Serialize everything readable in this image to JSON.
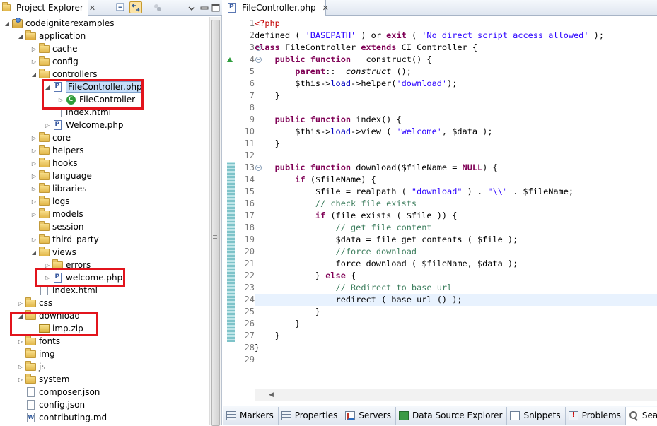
{
  "explorer": {
    "tab_title": "Project Explorer",
    "close_glyph": "✕",
    "toolbar": [
      "collapse-all-icon",
      "link-with-editor-icon",
      "filters-icon",
      "view-menu-icon"
    ],
    "tree": [
      {
        "label": "codeigniterexamples",
        "depth": 0,
        "type": "project",
        "expanded": true
      },
      {
        "label": "application",
        "depth": 1,
        "type": "folder",
        "expanded": true
      },
      {
        "label": "cache",
        "depth": 2,
        "type": "folder",
        "expanded": false
      },
      {
        "label": "config",
        "depth": 2,
        "type": "folder",
        "expanded": false
      },
      {
        "label": "controllers",
        "depth": 2,
        "type": "folder",
        "expanded": true
      },
      {
        "label": "FileController.php",
        "depth": 3,
        "type": "php",
        "expanded": true,
        "selected": true,
        "highlighted": true
      },
      {
        "label": "FileController",
        "depth": 4,
        "type": "class",
        "expanded": false,
        "highlighted": true
      },
      {
        "label": "index.html",
        "depth": 3,
        "type": "file",
        "expanded": null
      },
      {
        "label": "Welcome.php",
        "depth": 3,
        "type": "php",
        "expanded": false
      },
      {
        "label": "core",
        "depth": 2,
        "type": "folder",
        "expanded": false
      },
      {
        "label": "helpers",
        "depth": 2,
        "type": "folder",
        "expanded": false
      },
      {
        "label": "hooks",
        "depth": 2,
        "type": "folder",
        "expanded": false
      },
      {
        "label": "language",
        "depth": 2,
        "type": "folder",
        "expanded": false
      },
      {
        "label": "libraries",
        "depth": 2,
        "type": "folder",
        "expanded": false
      },
      {
        "label": "logs",
        "depth": 2,
        "type": "folder",
        "expanded": false
      },
      {
        "label": "models",
        "depth": 2,
        "type": "folder",
        "expanded": false
      },
      {
        "label": "session",
        "depth": 2,
        "type": "folder",
        "expanded": null
      },
      {
        "label": "third_party",
        "depth": 2,
        "type": "folder",
        "expanded": false
      },
      {
        "label": "views",
        "depth": 2,
        "type": "folder",
        "expanded": true
      },
      {
        "label": "errors",
        "depth": 3,
        "type": "folder",
        "expanded": false
      },
      {
        "label": "welcome.php",
        "depth": 3,
        "type": "php",
        "expanded": false,
        "highlighted": true
      },
      {
        "label": "index.html",
        "depth": 2,
        "type": "file",
        "expanded": null
      },
      {
        "label": "css",
        "depth": 1,
        "type": "folder",
        "expanded": false
      },
      {
        "label": "download",
        "depth": 1,
        "type": "folder",
        "expanded": true,
        "highlighted": true
      },
      {
        "label": "imp.zip",
        "depth": 2,
        "type": "zip",
        "expanded": null,
        "highlighted": true
      },
      {
        "label": "fonts",
        "depth": 1,
        "type": "folder",
        "expanded": false
      },
      {
        "label": "img",
        "depth": 1,
        "type": "folder",
        "expanded": null
      },
      {
        "label": "js",
        "depth": 1,
        "type": "folder",
        "expanded": false
      },
      {
        "label": "system",
        "depth": 1,
        "type": "folder",
        "expanded": false
      },
      {
        "label": "composer.json",
        "depth": 1,
        "type": "file",
        "expanded": null
      },
      {
        "label": "config.json",
        "depth": 1,
        "type": "file",
        "expanded": null
      },
      {
        "label": "contributing.md",
        "depth": 1,
        "type": "word",
        "expanded": null
      }
    ]
  },
  "editor": {
    "tab_title": "FileController.php",
    "close_glyph": "✕",
    "current_line": 24,
    "lines": [
      [
        [
          "tag",
          "<?php"
        ]
      ],
      [
        [
          "t",
          "defined ( "
        ],
        [
          "str",
          "'BASEPATH'"
        ],
        [
          "t",
          " ) or "
        ],
        [
          "kw",
          "exit"
        ],
        [
          "t",
          " ( "
        ],
        [
          "str",
          "'No direct script access allowed'"
        ],
        [
          "t",
          " );"
        ]
      ],
      [
        [
          "kw",
          "class"
        ],
        [
          "t",
          " FileController "
        ],
        [
          "kw",
          "extends"
        ],
        [
          "t",
          " CI_Controller {"
        ]
      ],
      [
        [
          "t",
          "    "
        ],
        [
          "kw",
          "public function"
        ],
        [
          "t",
          " __construct() {"
        ]
      ],
      [
        [
          "t",
          "        "
        ],
        [
          "kw",
          "parent"
        ],
        [
          "t",
          "::"
        ],
        [
          "fn",
          "__construct"
        ],
        [
          "t",
          " ();"
        ]
      ],
      [
        [
          "t",
          "        $this->"
        ],
        [
          "prop",
          "load"
        ],
        [
          "t",
          "->helper("
        ],
        [
          "str",
          "'download'"
        ],
        [
          "t",
          ");"
        ]
      ],
      [
        [
          "t",
          "    }"
        ]
      ],
      [
        [
          "t",
          ""
        ]
      ],
      [
        [
          "t",
          "    "
        ],
        [
          "kw",
          "public function"
        ],
        [
          "t",
          " index() {"
        ]
      ],
      [
        [
          "t",
          "        $this->"
        ],
        [
          "prop",
          "load"
        ],
        [
          "t",
          "->view ( "
        ],
        [
          "str",
          "'welcome'"
        ],
        [
          "t",
          ", $data );"
        ]
      ],
      [
        [
          "t",
          "    }"
        ]
      ],
      [
        [
          "t",
          ""
        ]
      ],
      [
        [
          "t",
          "    "
        ],
        [
          "kw",
          "public function"
        ],
        [
          "t",
          " download($fileName = "
        ],
        [
          "kw",
          "NULL"
        ],
        [
          "t",
          ") {"
        ]
      ],
      [
        [
          "t",
          "        "
        ],
        [
          "kw",
          "if"
        ],
        [
          "t",
          " ($fileName) {"
        ]
      ],
      [
        [
          "t",
          "            $file = realpath ( "
        ],
        [
          "str",
          "\"download\""
        ],
        [
          "t",
          " ) . "
        ],
        [
          "str",
          "\"\\\\\""
        ],
        [
          "t",
          " . $fileName;"
        ]
      ],
      [
        [
          "t",
          "            "
        ],
        [
          "cmt",
          "// check file exists"
        ]
      ],
      [
        [
          "t",
          "            "
        ],
        [
          "kw",
          "if"
        ],
        [
          "t",
          " (file_exists ( $file )) {"
        ]
      ],
      [
        [
          "t",
          "                "
        ],
        [
          "cmt",
          "// get file content"
        ]
      ],
      [
        [
          "t",
          "                $data = file_get_contents ( $file );"
        ]
      ],
      [
        [
          "t",
          "                "
        ],
        [
          "cmt",
          "//force download"
        ]
      ],
      [
        [
          "t",
          "                force_download ( $fileName, $data );"
        ]
      ],
      [
        [
          "t",
          "            } "
        ],
        [
          "kw",
          "else"
        ],
        [
          "t",
          " {"
        ]
      ],
      [
        [
          "t",
          "                "
        ],
        [
          "cmt",
          "// Redirect to base url"
        ]
      ],
      [
        [
          "t",
          "                redirect ( base_url () );"
        ]
      ],
      [
        [
          "t",
          "            }"
        ]
      ],
      [
        [
          "t",
          "        }"
        ]
      ],
      [
        [
          "t",
          "    }"
        ]
      ],
      [
        [
          "t",
          "}"
        ]
      ],
      [
        [
          "t",
          ""
        ]
      ]
    ],
    "fold_lines": [
      3,
      4,
      13
    ],
    "override_marker_line": 4,
    "diff_range": [
      13,
      27
    ]
  },
  "bottom_views": {
    "tabs": [
      {
        "label": "Markers",
        "icon": "markers-icon"
      },
      {
        "label": "Properties",
        "icon": "properties-icon"
      },
      {
        "label": "Servers",
        "icon": "servers-icon"
      },
      {
        "label": "Data Source Explorer",
        "icon": "data-source-explorer-icon"
      },
      {
        "label": "Snippets",
        "icon": "snippets-icon"
      },
      {
        "label": "Problems",
        "icon": "problems-icon"
      },
      {
        "label": "Search",
        "icon": "search-icon",
        "active": true
      }
    ]
  }
}
